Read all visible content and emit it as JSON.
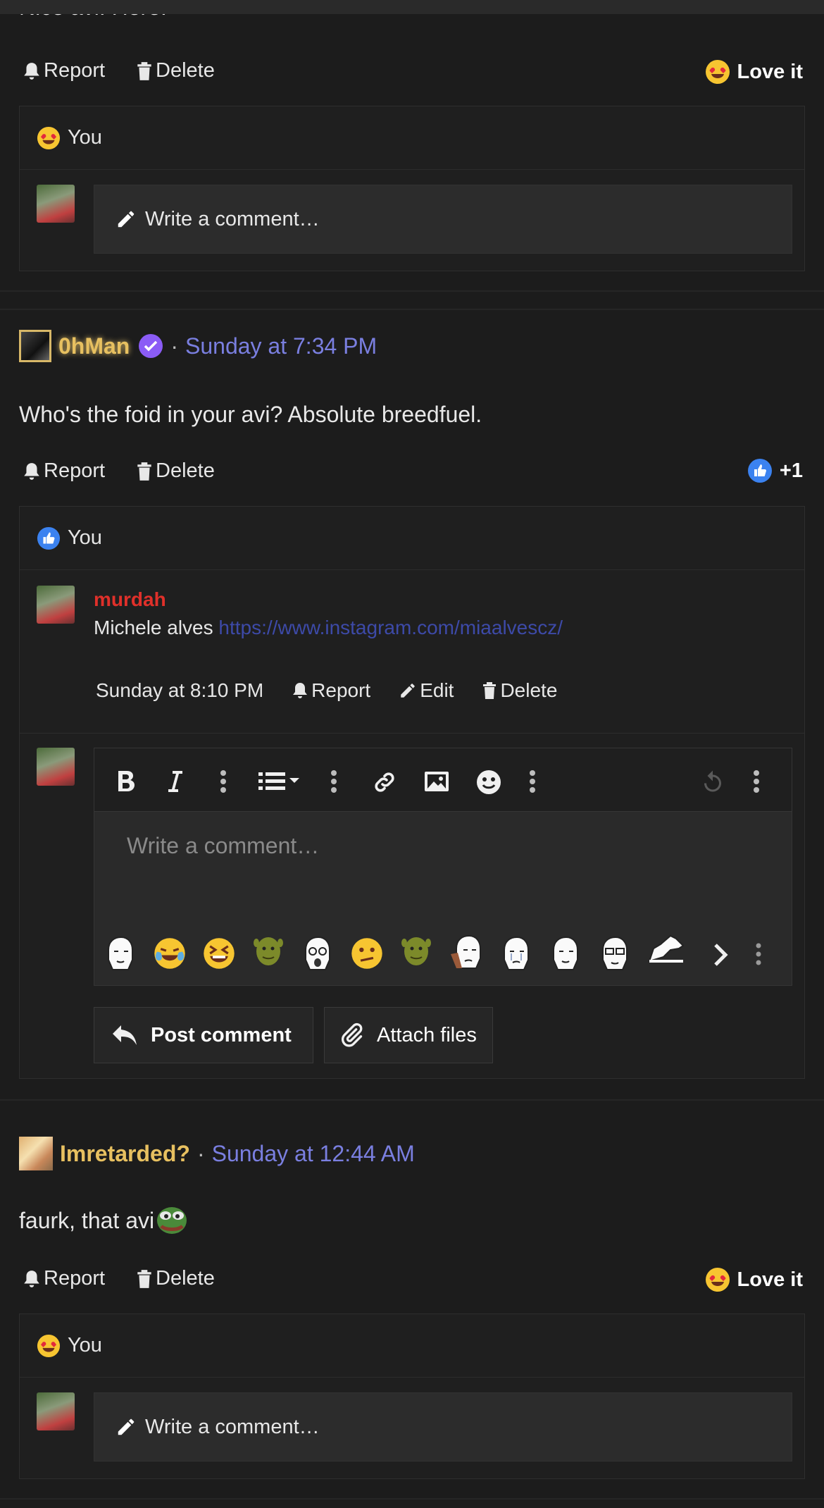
{
  "post1": {
    "partial_text": "Nice avi. Here.",
    "actions": {
      "report": "Report",
      "delete": "Delete"
    },
    "reaction": {
      "label": "Love it",
      "icon": "heart-eyes-emoji-icon"
    },
    "reactors": {
      "label": "You",
      "icon": "heart-eyes-emoji-icon"
    },
    "comment_placeholder": "Write a comment…"
  },
  "post2": {
    "username": "0hMan",
    "verified_icon": "verified-check-icon",
    "separator": "·",
    "timestamp": "Sunday at 7:34 PM",
    "text": "Who's the foid in your avi? Absolute breedfuel.",
    "actions": {
      "report": "Report",
      "delete": "Delete"
    },
    "reaction": {
      "label": "+1",
      "icon": "thumbs-up-icon"
    },
    "reactors": {
      "label": "You",
      "icon": "thumbs-up-icon"
    },
    "reply": {
      "username": "murdah",
      "text": "Michele alves",
      "link": "https://www.instagram.com/miaalvescz/",
      "timestamp": "Sunday at 8:10 PM",
      "actions": {
        "report": "Report",
        "edit": "Edit",
        "delete": "Delete"
      }
    },
    "editor": {
      "placeholder": "Write a comment…",
      "toolbar": [
        "bold-icon",
        "italic-icon",
        "more-vertical-icon",
        "list-icon",
        "more-vertical-icon",
        "link-icon",
        "image-icon",
        "smiley-icon",
        "more-vertical-icon",
        "undo-icon",
        "more-vertical-icon"
      ],
      "emoji_bar": [
        "wojak-emoji",
        "crying-laughing-emoji",
        "squinting-laugh-emoji",
        "shrek-emoji",
        "soyjak-emoji",
        "confused-emoji",
        "shrek-emoji",
        "coping-wojak-emoji",
        "crying-wojak-emoji",
        "wojak-emoji",
        "glasses-wojak-emoji",
        "chad-emoji"
      ]
    },
    "post_button": "Post comment",
    "attach_button": "Attach files"
  },
  "post3": {
    "username": "Imretarded?",
    "separator": "·",
    "timestamp": "Sunday at 12:44 AM",
    "text": "faurk, that avi",
    "actions": {
      "report": "Report",
      "delete": "Delete"
    },
    "reaction": {
      "label": "Love it",
      "icon": "heart-eyes-emoji-icon"
    },
    "reactors": {
      "label": "You",
      "icon": "heart-eyes-emoji-icon"
    },
    "comment_placeholder": "Write a comment…"
  },
  "colors": {
    "background": "#1c1c1c",
    "username_gold": "#e7c060",
    "username_red": "#e0302a",
    "timestamp": "#7a7fe0",
    "link": "#3d4aa8",
    "thumbs_blue": "#3b82f0",
    "verified_purple": "#8b5cf6"
  }
}
